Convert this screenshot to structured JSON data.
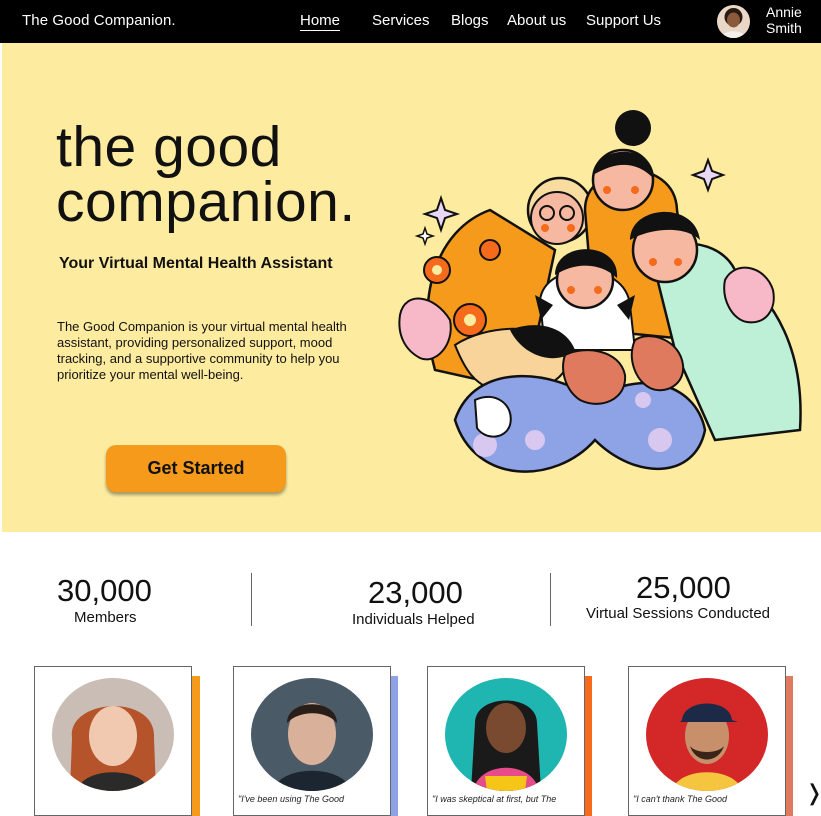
{
  "nav": {
    "brand": "The Good Companion.",
    "links": [
      "Home",
      "Services",
      "Blogs",
      "About us",
      "Support Us"
    ],
    "user_first": "Annie",
    "user_last": "Smith"
  },
  "hero": {
    "title_line1": "the good",
    "title_line2": "companion.",
    "subtitle": "Your Virtual Mental Health Assistant",
    "description": "The Good Companion is your virtual mental health assistant, providing personalized support, mood tracking, and a supportive community to help you prioritize your mental well-being.",
    "cta_label": "Get Started"
  },
  "stats": [
    {
      "value": "30,000",
      "label": "Members"
    },
    {
      "value": "23,000",
      "label": "Individuals Helped"
    },
    {
      "value": "25,000",
      "label": "Virtual Sessions Conducted"
    }
  ],
  "testimonials": [
    {
      "quote": "",
      "accent": "#f59a1b"
    },
    {
      "quote": "\"I've been using The Good",
      "accent": "#8ea3e6"
    },
    {
      "quote": "\"I was skeptical at first, but The",
      "accent": "#f56a1b"
    },
    {
      "quote": "\"I can't thank The Good",
      "accent": "#e07a5f"
    }
  ],
  "icons": {
    "next": "chevron-right-icon"
  },
  "colors": {
    "hero_bg": "#fdeca0",
    "cta": "#f59a1b",
    "nav_bg": "#000000"
  }
}
